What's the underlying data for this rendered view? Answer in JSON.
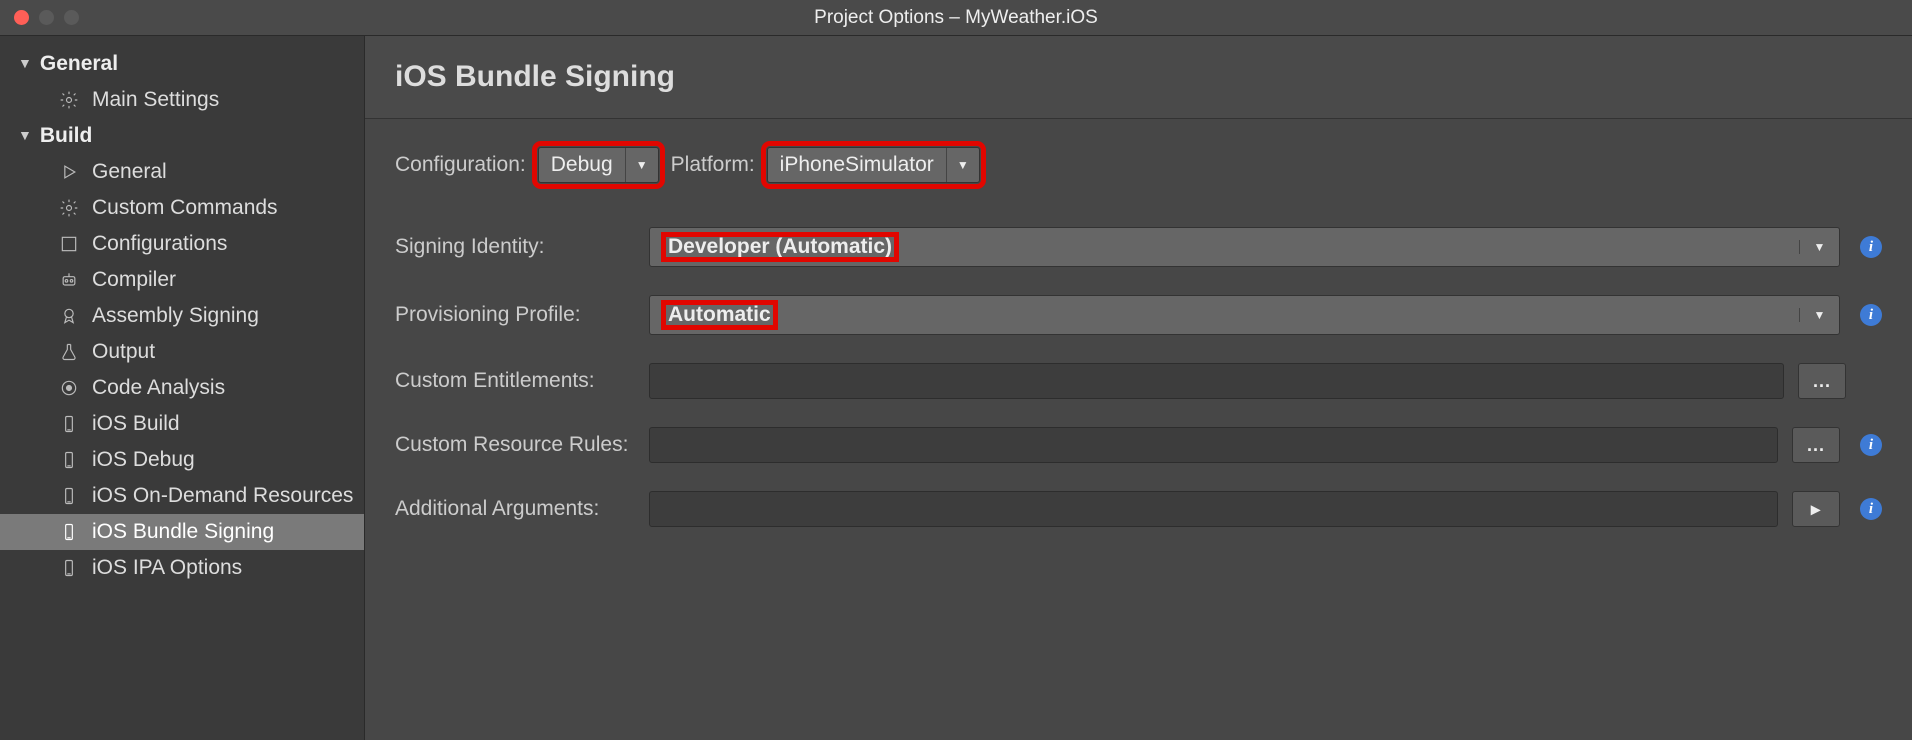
{
  "window": {
    "title": "Project Options – MyWeather.iOS"
  },
  "sidebar": {
    "sections": [
      {
        "header": "General",
        "items": [
          {
            "label": "Main Settings",
            "icon": "gear-icon"
          }
        ]
      },
      {
        "header": "Build",
        "items": [
          {
            "label": "General",
            "icon": "play-icon"
          },
          {
            "label": "Custom Commands",
            "icon": "gear-icon"
          },
          {
            "label": "Configurations",
            "icon": "square-icon"
          },
          {
            "label": "Compiler",
            "icon": "robot-icon"
          },
          {
            "label": "Assembly Signing",
            "icon": "medal-icon"
          },
          {
            "label": "Output",
            "icon": "flask-icon"
          },
          {
            "label": "Code Analysis",
            "icon": "target-icon"
          },
          {
            "label": "iOS Build",
            "icon": "device-icon"
          },
          {
            "label": "iOS Debug",
            "icon": "device-icon"
          },
          {
            "label": "iOS On-Demand Resources",
            "icon": "device-icon"
          },
          {
            "label": "iOS Bundle Signing",
            "icon": "device-icon",
            "selected": true
          },
          {
            "label": "iOS IPA Options",
            "icon": "device-icon"
          }
        ]
      }
    ]
  },
  "page": {
    "title": "iOS Bundle Signing",
    "config_label": "Configuration:",
    "config_value": "Debug",
    "platform_label": "Platform:",
    "platform_value": "iPhoneSimulator",
    "rows": {
      "signing_identity_label": "Signing Identity:",
      "signing_identity_value": "Developer (Automatic)",
      "provisioning_label": "Provisioning Profile:",
      "provisioning_value": "Automatic",
      "entitlements_label": "Custom Entitlements:",
      "entitlements_value": "",
      "resource_rules_label": "Custom Resource Rules:",
      "resource_rules_value": "",
      "additional_args_label": "Additional Arguments:",
      "additional_args_value": ""
    },
    "browse_btn": "...",
    "run_btn": "▸"
  }
}
